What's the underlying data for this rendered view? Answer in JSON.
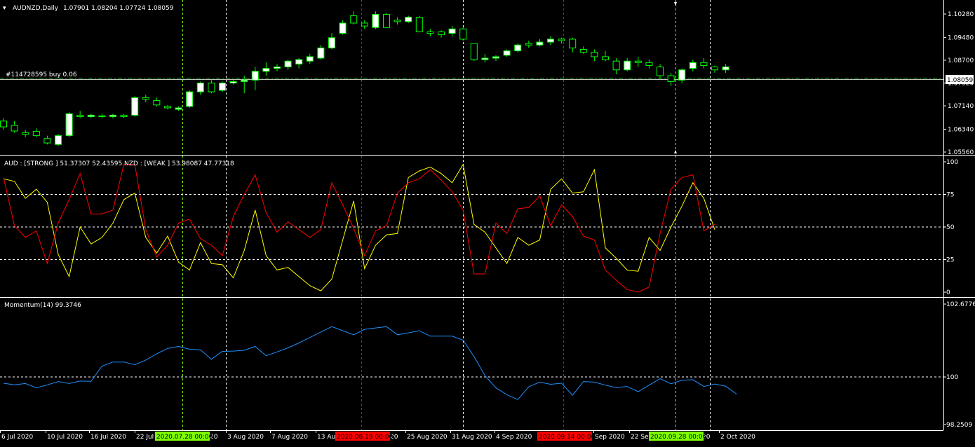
{
  "main": {
    "title": "AUDNZD,Daily",
    "ohlc": "1.07901 1.08204 1.07724 1.08059",
    "order_label": "#114728595 buy 0.06",
    "current_price": "1.08059",
    "price_ticks": [
      "1.10280",
      "1.09480",
      "1.08700",
      "1.07920",
      "1.07140",
      "1.06340",
      "1.05560"
    ]
  },
  "currency_strength": {
    "header": "AUD : [STRONG ]    51.37307 52.43595  NZD : [WEAK ]    53.98087 47.77318",
    "ticks": [
      "100",
      "75",
      "50",
      "25",
      "0"
    ]
  },
  "momentum": {
    "header": "Momentum(14) 99.3746",
    "ticks": [
      "102.6776",
      "100",
      "98.2509"
    ]
  },
  "date_axis": {
    "labels": [
      "6 Jul 2020",
      "10 Jul 2020",
      "16 Jul 2020",
      "22 Jul",
      "3 Aug 2020",
      "7 Aug 2020",
      "13 Au",
      "25 Aug 2020",
      "31 Aug 2020",
      "4 Sep 2020",
      "Sep 2020",
      "22 Se",
      "2 Oct 2020"
    ],
    "suffix_labels": [
      "20",
      "20",
      "20"
    ],
    "tags": [
      {
        "text": "2020.07.28 00:00",
        "color": "#7fff00"
      },
      {
        "text": "2020.08.19 00:00",
        "color": "#ff0000"
      },
      {
        "text": "2020.09.14 00:00",
        "color": "#ff0000"
      },
      {
        "text": "2020.09.28 00:00",
        "color": "#7fff00"
      }
    ]
  },
  "colors": {
    "bull_body": "#ffffff",
    "bear_body": "#000000",
    "candle_wick": "#00ff00",
    "aud_line": "#ffff00",
    "nzd_line": "#ff0000",
    "momentum_line": "#1e90ff",
    "green_vline": "#7fff00",
    "red_vline": "#ff0000"
  },
  "chart_data": [
    {
      "type": "candlestick",
      "title": "AUDNZD,Daily",
      "ylim": [
        1.0556,
        1.1028
      ],
      "ohlc": [
        [
          1.0662,
          1.0672,
          1.0632,
          1.0642
        ],
        [
          1.0647,
          1.0662,
          1.0622,
          1.0628
        ],
        [
          1.0622,
          1.0632,
          1.0607,
          1.0617
        ],
        [
          1.0627,
          1.0637,
          1.0607,
          1.0612
        ],
        [
          1.0602,
          1.0612,
          1.0582,
          1.0587
        ],
        [
          1.0582,
          1.0618,
          1.0577,
          1.0612
        ],
        [
          1.0612,
          1.0692,
          1.0607,
          1.0687
        ],
        [
          1.0682,
          1.0697,
          1.0672,
          1.0677
        ],
        [
          1.0677,
          1.0687,
          1.0672,
          1.0682
        ],
        [
          1.068,
          1.0687,
          1.0672,
          1.0677
        ],
        [
          1.0677,
          1.0687,
          1.0672,
          1.0682
        ],
        [
          1.0682,
          1.0687,
          1.0672,
          1.0677
        ],
        [
          1.0682,
          1.0747,
          1.0677,
          1.0742
        ],
        [
          1.0742,
          1.0752,
          1.0727,
          1.0737
        ],
        [
          1.0732,
          1.0742,
          1.0712,
          1.0717
        ],
        [
          1.0712,
          1.0717,
          1.0702,
          1.0707
        ],
        [
          1.0702,
          1.0712,
          1.0697,
          1.0707
        ],
        [
          1.0712,
          1.0767,
          1.0707,
          1.0762
        ],
        [
          1.0762,
          1.0797,
          1.0752,
          1.0792
        ],
        [
          1.0792,
          1.0802,
          1.0757,
          1.0762
        ],
        [
          1.0767,
          1.0797,
          1.0762,
          1.0792
        ],
        [
          1.0792,
          1.0802,
          1.0787,
          1.0797
        ],
        [
          1.0797,
          1.0817,
          1.0757,
          1.0802
        ],
        [
          1.0802,
          1.0847,
          1.0767,
          1.0832
        ],
        [
          1.0832,
          1.0862,
          1.0817,
          1.0842
        ],
        [
          1.0842,
          1.0857,
          1.0832,
          1.0847
        ],
        [
          1.0847,
          1.0872,
          1.0837,
          1.0867
        ],
        [
          1.0857,
          1.0877,
          1.0842,
          1.0872
        ],
        [
          1.0867,
          1.0892,
          1.0857,
          1.0882
        ],
        [
          1.0877,
          1.0922,
          1.0872,
          1.0912
        ],
        [
          1.0912,
          1.0962,
          1.0907,
          1.0947
        ],
        [
          1.0962,
          1.1007,
          1.0957,
          1.0997
        ],
        [
          1.1022,
          1.1037,
          1.0992,
          1.0997
        ],
        [
          1.0997,
          1.1007,
          1.0977,
          1.0987
        ],
        [
          1.0982,
          1.1037,
          1.0977,
          1.1027
        ],
        [
          1.1027,
          1.1032,
          1.0987,
          1.0982
        ],
        [
          1.1007,
          1.1017,
          1.0992,
          1.1002
        ],
        [
          1.1002,
          1.1022,
          1.0997,
          1.1017
        ],
        [
          1.1017,
          1.1022,
          1.0967,
          1.0967
        ],
        [
          1.0967,
          1.0977,
          1.0952,
          1.0962
        ],
        [
          1.0967,
          1.0972,
          1.0947,
          1.0957
        ],
        [
          1.0962,
          1.0987,
          1.0952,
          1.0977
        ],
        [
          1.0977,
          1.0982,
          1.0937,
          1.0942
        ],
        [
          1.0927,
          1.0927,
          1.0867,
          1.0872
        ],
        [
          1.0872,
          1.0892,
          1.0862,
          1.0877
        ],
        [
          1.0877,
          1.0887,
          1.0867,
          1.0882
        ],
        [
          1.0887,
          1.0907,
          1.0882,
          1.0902
        ],
        [
          1.0902,
          1.0927,
          1.0897,
          1.0922
        ],
        [
          1.0927,
          1.0937,
          1.0912,
          1.0922
        ],
        [
          1.0922,
          1.0942,
          1.0917,
          1.0932
        ],
        [
          1.0932,
          1.0952,
          1.0922,
          1.0942
        ],
        [
          1.0942,
          1.0947,
          1.0927,
          1.0937
        ],
        [
          1.0942,
          1.0947,
          1.0897,
          1.0912
        ],
        [
          1.0907,
          1.0917,
          1.0892,
          1.0897
        ],
        [
          1.0897,
          1.0907,
          1.0867,
          1.0882
        ],
        [
          1.0882,
          1.0902,
          1.0867,
          1.0872
        ],
        [
          1.0867,
          1.0877,
          1.0822,
          1.0837
        ],
        [
          1.0837,
          1.0877,
          1.0832,
          1.0867
        ],
        [
          1.0867,
          1.0882,
          1.0847,
          1.0862
        ],
        [
          1.0862,
          1.0872,
          1.0842,
          1.0852
        ],
        [
          1.0847,
          1.0857,
          1.0807,
          1.0817
        ],
        [
          1.0817,
          1.0827,
          1.0782,
          1.0797
        ],
        [
          1.0802,
          1.0842,
          1.0792,
          1.0837
        ],
        [
          1.0842,
          1.0872,
          1.0832,
          1.0862
        ],
        [
          1.0862,
          1.0877,
          1.0842,
          1.0852
        ],
        [
          1.0847,
          1.0852,
          1.0827,
          1.0837
        ],
        [
          1.0837,
          1.0857,
          1.0827,
          1.0847
        ]
      ]
    },
    {
      "type": "line",
      "header": "AUD : [STRONG ]    51.37307 52.43595  NZD : [WEAK ]    53.98087 47.77318",
      "ylim": [
        0,
        100
      ],
      "series": [
        {
          "values": [
            87,
            85,
            72,
            79,
            69,
            29,
            12,
            50,
            37,
            42,
            53,
            71,
            76,
            42,
            30,
            43,
            23,
            17,
            38,
            22,
            21,
            11,
            32,
            63,
            28,
            17,
            19,
            12,
            5,
            1,
            10,
            40,
            70,
            18,
            36,
            44,
            45,
            88,
            93,
            96,
            91,
            84,
            98,
            52,
            46,
            34,
            22,
            42,
            36,
            40,
            79,
            87,
            76,
            77,
            94,
            34,
            26,
            17,
            16,
            42,
            32,
            50,
            66,
            84,
            72,
            48
          ]
        },
        {
          "values": [
            88,
            51,
            42,
            47,
            22,
            53,
            71,
            91,
            60,
            60,
            63,
            98,
            98,
            48,
            27,
            36,
            53,
            56,
            41,
            36,
            28,
            58,
            75,
            90,
            61,
            46,
            54,
            48,
            42,
            48,
            84,
            67,
            49,
            28,
            47,
            51,
            76,
            84,
            87,
            94,
            86,
            77,
            63,
            14,
            14,
            53,
            45,
            64,
            65,
            74,
            51,
            67,
            58,
            43,
            40,
            17,
            9,
            2,
            0,
            4,
            45,
            79,
            88,
            90,
            47,
            52
          ]
        }
      ]
    },
    {
      "type": "line",
      "header": "Momentum(14) 99.3746",
      "ylim": [
        98.2509,
        102.6776
      ],
      "series": [
        {
          "values": [
            99.77,
            99.71,
            99.76,
            99.6,
            99.71,
            99.83,
            99.76,
            99.85,
            99.84,
            100.4,
            100.55,
            100.55,
            100.45,
            100.62,
            100.85,
            101.05,
            101.12,
            101.02,
            101.0,
            100.65,
            100.94,
            100.95,
            100.98,
            101.12,
            100.78,
            100.92,
            101.07,
            101.25,
            101.45,
            101.65,
            101.85,
            101.7,
            101.55,
            101.75,
            101.8,
            101.85,
            101.55,
            101.62,
            101.7,
            101.5,
            101.5,
            101.5,
            101.35,
            100.75,
            100.05,
            99.6,
            99.35,
            99.17,
            99.64,
            99.81,
            99.73,
            99.77,
            99.33,
            99.83,
            99.81,
            99.7,
            99.61,
            99.65,
            99.46,
            99.7,
            99.94,
            99.75,
            99.88,
            99.9,
            99.65,
            99.74,
            99.66,
            99.37
          ]
        }
      ]
    }
  ]
}
